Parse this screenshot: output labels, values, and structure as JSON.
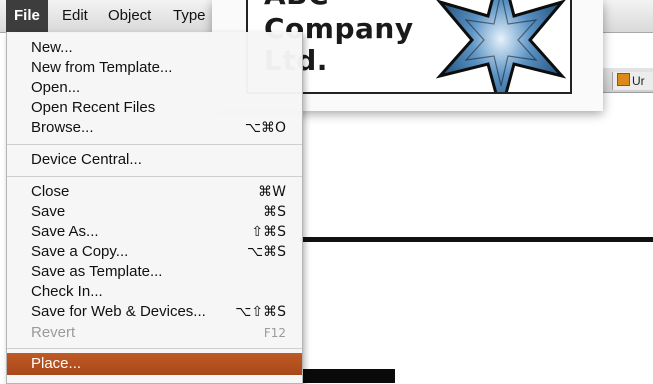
{
  "menubar": {
    "items": [
      "File",
      "Edit",
      "Object",
      "Type"
    ]
  },
  "document": {
    "tab_label": "Ur"
  },
  "logo": {
    "line1": "ABC",
    "line2": "Company",
    "line3": "Ltd."
  },
  "file_menu": {
    "items": [
      {
        "label": "New...",
        "shortcut": ""
      },
      {
        "label": "New from Template...",
        "shortcut": ""
      },
      {
        "label": "Open...",
        "shortcut": ""
      },
      {
        "label": "Open Recent Files",
        "shortcut": ""
      },
      {
        "label": "Browse...",
        "shortcut": "⌥⌘O"
      },
      {
        "label": "Device Central...",
        "shortcut": ""
      },
      {
        "label": "Close",
        "shortcut": "⌘W"
      },
      {
        "label": "Save",
        "shortcut": "⌘S"
      },
      {
        "label": "Save As...",
        "shortcut": "⇧⌘S"
      },
      {
        "label": "Save a Copy...",
        "shortcut": "⌥⌘S"
      },
      {
        "label": "Save as Template...",
        "shortcut": ""
      },
      {
        "label": "Check In...",
        "shortcut": ""
      },
      {
        "label": "Save for Web & Devices...",
        "shortcut": "⌥⇧⌘S"
      },
      {
        "label": "Revert",
        "shortcut": "F12"
      },
      {
        "label": "Place...",
        "shortcut": ""
      }
    ]
  }
}
